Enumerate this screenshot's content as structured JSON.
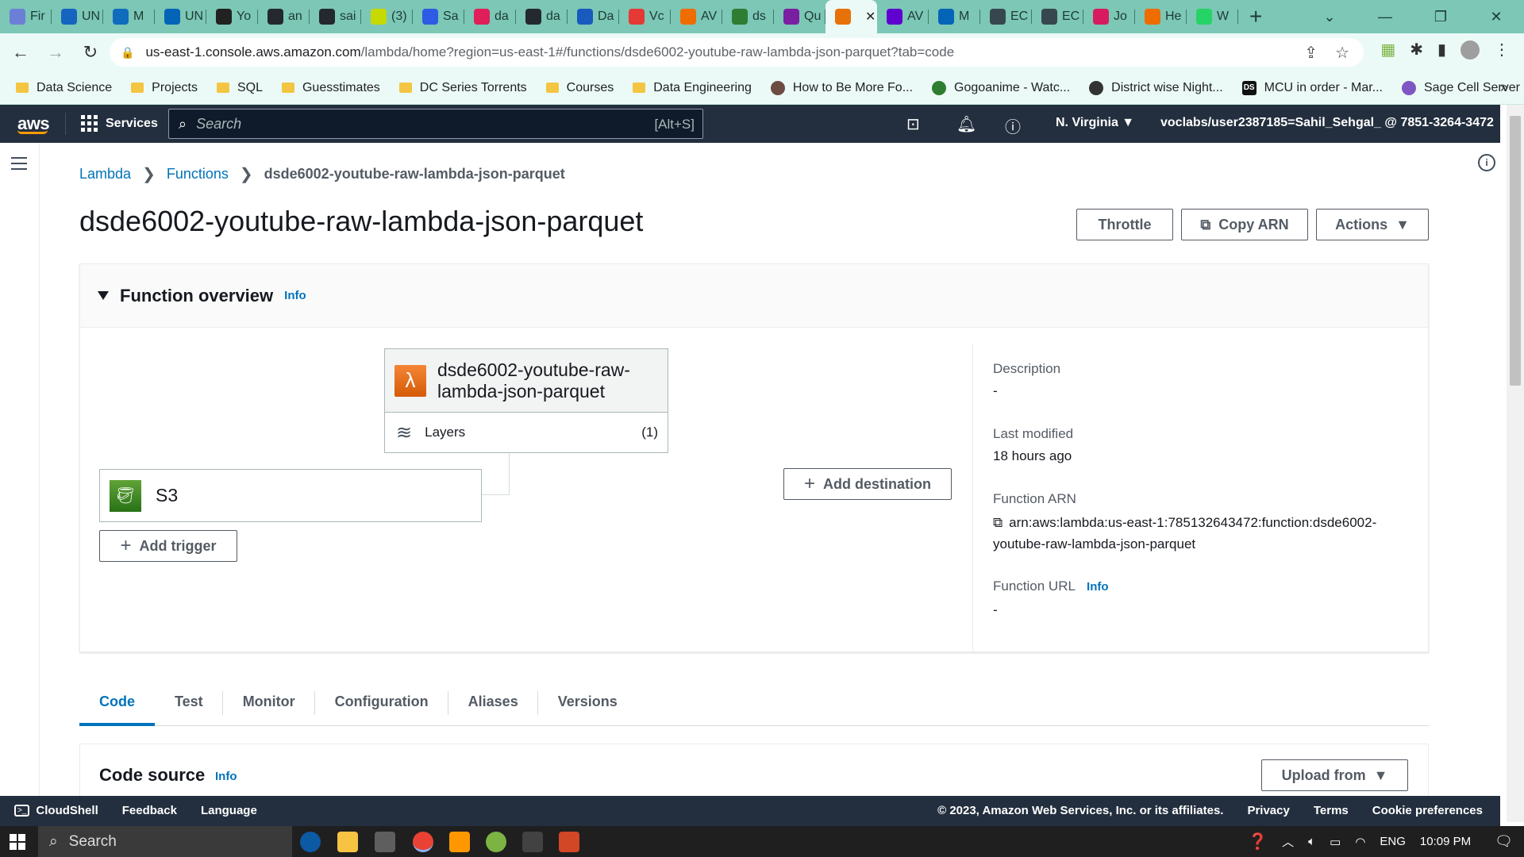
{
  "browser": {
    "tabs": [
      {
        "label": "Fir",
        "icon": "gear-icon",
        "color": "#6b7fd7"
      },
      {
        "label": "UN",
        "icon": "k-icon",
        "color": "#1565c0"
      },
      {
        "label": "M",
        "icon": "outlook-icon",
        "color": "#0f6cbd"
      },
      {
        "label": "UN",
        "icon": "onedrive-icon",
        "color": "#0364b8"
      },
      {
        "label": "Yo",
        "icon": "amazon-icon",
        "color": "#222222"
      },
      {
        "label": "an",
        "icon": "github-icon",
        "color": "#24292f"
      },
      {
        "label": "sai",
        "icon": "github-icon",
        "color": "#24292f"
      },
      {
        "label": "(3)",
        "icon": "h-icon",
        "color": "#c6d900"
      },
      {
        "label": "Sa",
        "icon": "w-icon",
        "color": "#2d5be3"
      },
      {
        "label": "da",
        "icon": "slack-icon",
        "color": "#e01e5a"
      },
      {
        "label": "da",
        "icon": "github-icon",
        "color": "#24292f"
      },
      {
        "label": "Da",
        "icon": "word-icon",
        "color": "#185abd"
      },
      {
        "label": "Vc",
        "icon": "vocareum-icon",
        "color": "#e53935"
      },
      {
        "label": "AV",
        "icon": "box-icon",
        "color": "#ef6c00"
      },
      {
        "label": "ds",
        "icon": "s3-icon",
        "color": "#2e7d32"
      },
      {
        "label": "Qu",
        "icon": "athena-icon",
        "color": "#7b1fa2"
      },
      {
        "label": "",
        "icon": "lambda-icon",
        "color": "#e8710a",
        "active": true
      },
      {
        "label": "AV",
        "icon": "yahoo-icon",
        "color": "#6001d2"
      },
      {
        "label": "M",
        "icon": "onedrive-icon",
        "color": "#0364b8"
      },
      {
        "label": "EC",
        "icon": "ec-icon",
        "color": "#37474f"
      },
      {
        "label": "EC",
        "icon": "ec-icon",
        "color": "#37474f"
      },
      {
        "label": "Jo",
        "icon": "s-icon",
        "color": "#d81b60"
      },
      {
        "label": "He",
        "icon": "h-icon",
        "color": "#ef6c00"
      },
      {
        "label": "W",
        "icon": "whatsapp-icon",
        "color": "#25d366"
      }
    ],
    "close_tab": "✕",
    "new_tab": "+",
    "url_host": "us-east-1.console.aws.amazon.com",
    "url_path": "/lambda/home?region=us-east-1#/functions/dsde6002-youtube-raw-lambda-json-parquet?tab=code",
    "bookmarks": [
      {
        "label": "Data Science",
        "type": "folder"
      },
      {
        "label": "Projects",
        "type": "folder"
      },
      {
        "label": "SQL",
        "type": "folder"
      },
      {
        "label": "Guesstimates",
        "type": "folder"
      },
      {
        "label": "DC Series Torrents",
        "type": "folder"
      },
      {
        "label": "Courses",
        "type": "folder"
      },
      {
        "label": "Data Engineering",
        "type": "folder"
      },
      {
        "label": "How to Be More Fo...",
        "type": "link",
        "color": "#6d4c41"
      },
      {
        "label": "Gogoanime - Watc...",
        "type": "link",
        "color": "#2e7d32"
      },
      {
        "label": "District wise Night...",
        "type": "link",
        "color": "#333333"
      },
      {
        "label": "MCU in order - Mar...",
        "type": "link",
        "color": "#111111",
        "text": "DS"
      },
      {
        "label": "Sage Cell Server",
        "type": "link",
        "color": "#7e57c2"
      }
    ]
  },
  "aws_header": {
    "logo": "aws",
    "services": "Services",
    "search_placeholder": "Search",
    "search_shortcut": "[Alt+S]",
    "region": "N. Virginia ▼",
    "account": "voclabs/user2387185=Sahil_Sehgal_ @ 7851-3264-3472 ▼"
  },
  "breadcrumb": {
    "items": [
      "Lambda",
      "Functions"
    ],
    "current": "dsde6002-youtube-raw-lambda-json-parquet",
    "separator": "❯"
  },
  "page": {
    "title": "dsde6002-youtube-raw-lambda-json-parquet",
    "throttle": "Throttle",
    "copy_arn": "Copy ARN",
    "actions": "Actions"
  },
  "overview": {
    "heading": "Function overview",
    "info": "Info",
    "function_name_line1": "dsde6002-youtube-raw-",
    "function_name_line2": "lambda-json-parquet",
    "layers_label": "Layers",
    "layers_count": "(1)",
    "trigger_label": "S3",
    "add_trigger": "Add trigger",
    "add_destination": "Add destination",
    "description_label": "Description",
    "description_value": "-",
    "last_modified_label": "Last modified",
    "last_modified_value": "18 hours ago",
    "arn_label": "Function ARN",
    "arn_line1": "arn:aws:lambda:us-east-1:785132643472:function:dsde6002-",
    "arn_line2": "youtube-raw-lambda-json-parquet",
    "url_label": "Function URL",
    "url_info": "Info",
    "url_value": "-"
  },
  "tabs": [
    "Code",
    "Test",
    "Monitor",
    "Configuration",
    "Aliases",
    "Versions"
  ],
  "active_tab": "Code",
  "code_source": {
    "heading": "Code source",
    "info": "Info",
    "upload": "Upload from"
  },
  "footer": {
    "cloudshell": "CloudShell",
    "feedback": "Feedback",
    "language": "Language",
    "copyright": "© 2023, Amazon Web Services, Inc. or its affiliates.",
    "privacy": "Privacy",
    "terms": "Terms",
    "cookies": "Cookie preferences"
  },
  "taskbar": {
    "search": "Search",
    "lang": "ENG",
    "time": "10:09 PM"
  },
  "colors": {
    "aws_dark": "#232f3e",
    "aws_orange": "#ff9900",
    "link_blue": "#0073bb",
    "browser_tabstrip": "#7cc7b5",
    "browser_toolbar": "#ebfaf6"
  }
}
